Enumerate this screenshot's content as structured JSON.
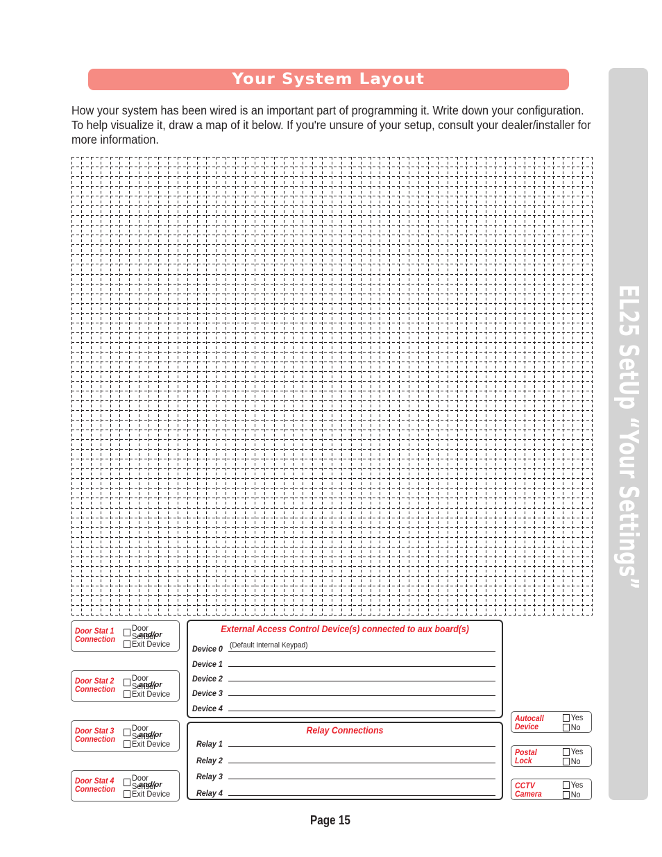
{
  "header": {
    "title": "Your System Layout",
    "accent_color": "#f68b83"
  },
  "intro_text": "How your system has been wired is an important part of programming it. Write down your configuration. To help visualize it, draw a map of it below. If you're unsure of your setup, consult your dealer/installer for more information.",
  "side_tab": {
    "label": "EL25 SetUp “Your Settings”",
    "color": "#d3d3d3"
  },
  "drawing_grid": {
    "columns": 54,
    "rows": 47,
    "style": "dashed"
  },
  "door_stats": [
    {
      "label_line1": "Door Stat 1",
      "label_line2": "Connection",
      "option1": "Door Sensor",
      "joiner": "and/or",
      "option2": "Exit Device",
      "option1_checked": false,
      "option2_checked": false
    },
    {
      "label_line1": "Door Stat 2",
      "label_line2": "Connection",
      "option1": "Door Sensor",
      "joiner": "and/or",
      "option2": "Exit Device",
      "option1_checked": false,
      "option2_checked": false
    },
    {
      "label_line1": "Door Stat 3",
      "label_line2": "Connection",
      "option1": "Door Sensor",
      "joiner": "and/or",
      "option2": "Exit Device",
      "option1_checked": false,
      "option2_checked": false
    },
    {
      "label_line1": "Door Stat 4",
      "label_line2": "Connection",
      "option1": "Door Sensor",
      "joiner": "and/or",
      "option2": "Exit Device",
      "option1_checked": false,
      "option2_checked": false
    }
  ],
  "external_devices": {
    "title": "External Access Control Device(s) connected to aux board(s)",
    "rows": [
      {
        "label": "Device 0",
        "value": "(Default Internal Keypad)"
      },
      {
        "label": "Device 1",
        "value": ""
      },
      {
        "label": "Device 2",
        "value": ""
      },
      {
        "label": "Device 3",
        "value": ""
      },
      {
        "label": "Device 4",
        "value": ""
      }
    ]
  },
  "relay_connections": {
    "title": "Relay Connections",
    "rows": [
      {
        "label": "Relay 1",
        "value": ""
      },
      {
        "label": "Relay 2",
        "value": ""
      },
      {
        "label": "Relay 3",
        "value": ""
      },
      {
        "label": "Relay 4",
        "value": ""
      }
    ]
  },
  "yes_no_options": [
    {
      "label_line1": "Autocall",
      "label_line2": "Device",
      "yes": "Yes",
      "no": "No",
      "yes_checked": false,
      "no_checked": false
    },
    {
      "label_line1": "Postal",
      "label_line2": "Lock",
      "yes": "Yes",
      "no": "No",
      "yes_checked": false,
      "no_checked": false
    },
    {
      "label_line1": "CCTV",
      "label_line2": "Camera",
      "yes": "Yes",
      "no": "No",
      "yes_checked": false,
      "no_checked": false
    }
  ],
  "label_color": "#e8202a",
  "footer": {
    "page_label": "Page 15"
  }
}
